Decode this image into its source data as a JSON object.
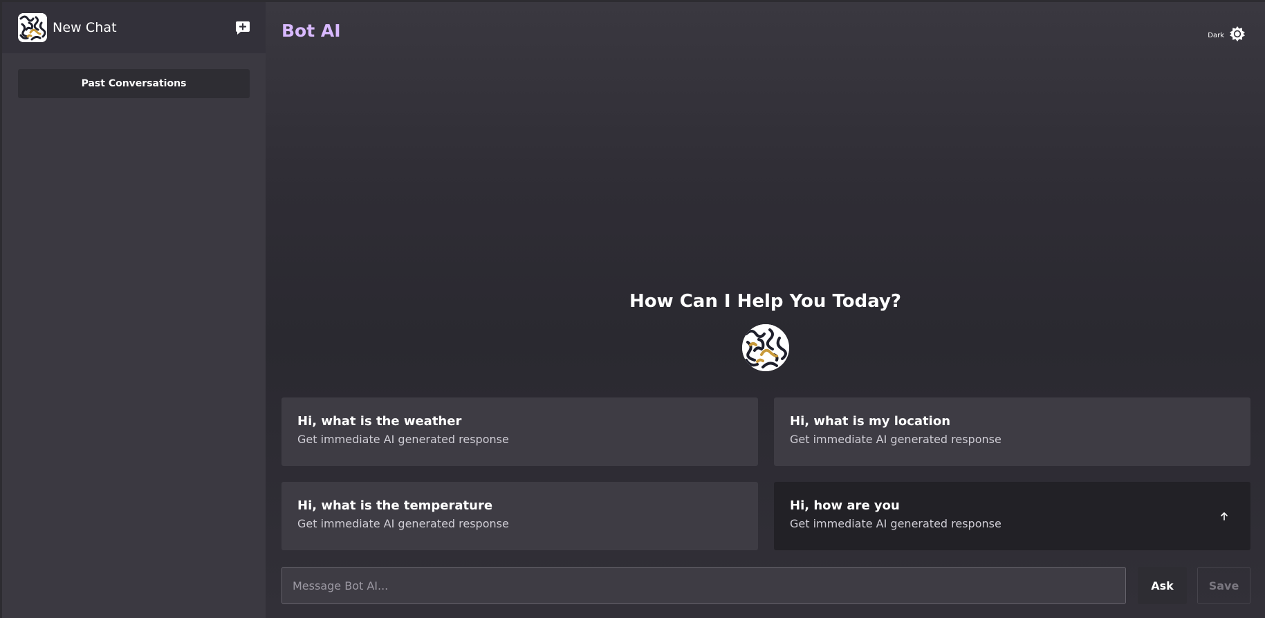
{
  "sidebar": {
    "new_chat_label": "New Chat",
    "past_conversations_label": "Past Conversations"
  },
  "header": {
    "title": "Bot AI",
    "theme_label": "Dark"
  },
  "main": {
    "greeting": "How Can I Help You Today?",
    "cards": [
      {
        "title": "Hi, what is the weather",
        "subtitle": "Get immediate AI generated response"
      },
      {
        "title": "Hi, what is my location",
        "subtitle": "Get immediate AI generated response"
      },
      {
        "title": "Hi, what is the temperature",
        "subtitle": "Get immediate AI generated response"
      },
      {
        "title": "Hi, how are you",
        "subtitle": "Get immediate AI generated response"
      }
    ]
  },
  "composer": {
    "placeholder": "Message Bot AI...",
    "value": "",
    "ask_label": "Ask",
    "save_label": "Save"
  },
  "colors": {
    "accent": "#d8b9ff",
    "sidebar_bg": "#3b3941",
    "card_bg": "#3e3c44",
    "card_hover_bg": "#222126"
  },
  "icons": {
    "new_chat": "chat-plus-icon",
    "theme": "sun-icon",
    "card_arrow": "arrow-up-icon"
  }
}
